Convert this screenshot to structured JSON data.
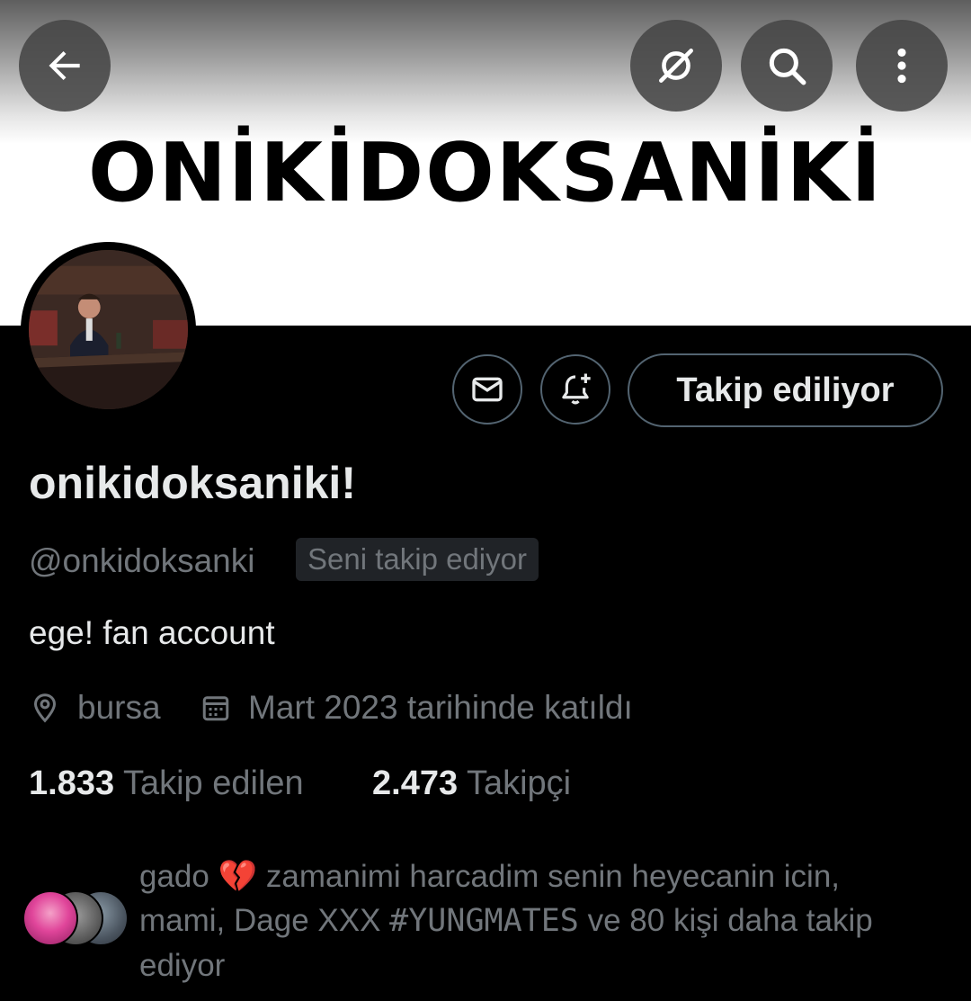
{
  "header": {
    "banner_text": "ONİKİDOKSANİKİ",
    "back_icon": "arrow-left-icon",
    "grok_icon": "grok-icon",
    "search_icon": "search-icon",
    "more_icon": "more-vertical-icon"
  },
  "actions": {
    "message_icon": "mail-icon",
    "notify_icon": "bell-plus-icon",
    "follow_label": "Takip ediliyor"
  },
  "profile": {
    "display_name": "onikidoksaniki!",
    "handle": "@onkidoksanki",
    "follows_you": "Seni takip ediyor",
    "bio": "ege! fan account",
    "location": "bursa",
    "joined": "Mart 2023 tarihinde katıldı"
  },
  "stats": {
    "following_count": "1.833",
    "following_label": "Takip edilen",
    "followers_count": "2.473",
    "followers_label": "Takipçi"
  },
  "followed_by": {
    "name1": "gado",
    "emoji": "💔",
    "text1": " zamanimi harcadim senin heyecanin icin,",
    "text2": "mami, Dage XXX ",
    "tag": "#YUNGMATES",
    "text3": " ve 80 kişi daha takip",
    "text4": "ediyor"
  },
  "colors": {
    "background": "#000000",
    "text_primary": "#e7e9ea",
    "text_secondary": "#71767b",
    "border": "#536471"
  }
}
